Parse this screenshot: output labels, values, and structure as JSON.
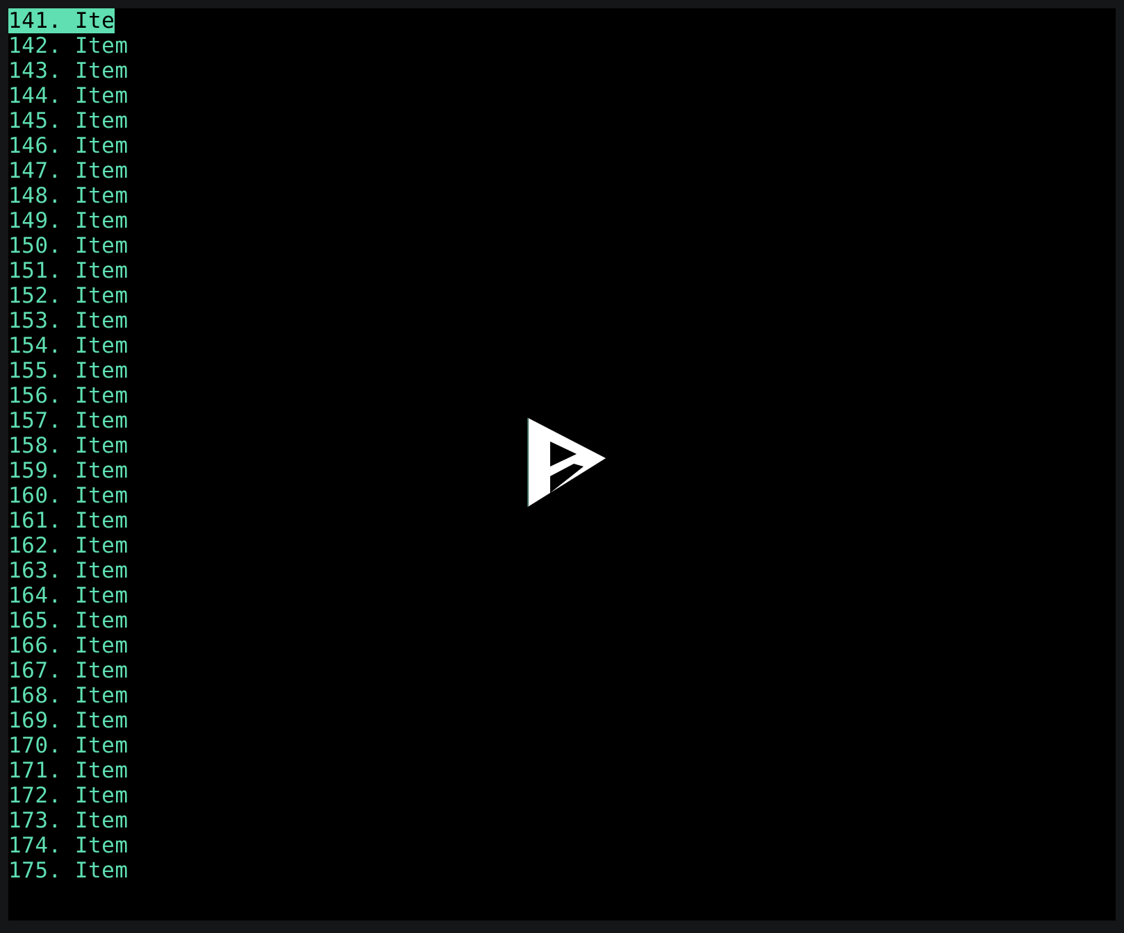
{
  "window": {
    "background_color": "#141617",
    "screen_background_color": "#000000"
  },
  "terminal": {
    "foreground_color": "#5FDFB2",
    "selection_background_color": "#5FDFB2",
    "selection_foreground_color": "#000000",
    "selected_index": 0,
    "first_visible_number": 141,
    "last_visible_number": 175,
    "items": [
      {
        "index": "141.",
        "label": "Item",
        "selected": true
      },
      {
        "index": "142.",
        "label": "Item",
        "selected": false
      },
      {
        "index": "143.",
        "label": "Item",
        "selected": false
      },
      {
        "index": "144.",
        "label": "Item",
        "selected": false
      },
      {
        "index": "145.",
        "label": "Item",
        "selected": false
      },
      {
        "index": "146.",
        "label": "Item",
        "selected": false
      },
      {
        "index": "147.",
        "label": "Item",
        "selected": false
      },
      {
        "index": "148.",
        "label": "Item",
        "selected": false
      },
      {
        "index": "149.",
        "label": "Item",
        "selected": false
      },
      {
        "index": "150.",
        "label": "Item",
        "selected": false
      },
      {
        "index": "151.",
        "label": "Item",
        "selected": false
      },
      {
        "index": "152.",
        "label": "Item",
        "selected": false
      },
      {
        "index": "153.",
        "label": "Item",
        "selected": false
      },
      {
        "index": "154.",
        "label": "Item",
        "selected": false
      },
      {
        "index": "155.",
        "label": "Item",
        "selected": false
      },
      {
        "index": "156.",
        "label": "Item",
        "selected": false
      },
      {
        "index": "157.",
        "label": "Item",
        "selected": false
      },
      {
        "index": "158.",
        "label": "Item",
        "selected": false
      },
      {
        "index": "159.",
        "label": "Item",
        "selected": false
      },
      {
        "index": "160.",
        "label": "Item",
        "selected": false
      },
      {
        "index": "161.",
        "label": "Item",
        "selected": false
      },
      {
        "index": "162.",
        "label": "Item",
        "selected": false
      },
      {
        "index": "163.",
        "label": "Item",
        "selected": false
      },
      {
        "index": "164.",
        "label": "Item",
        "selected": false
      },
      {
        "index": "165.",
        "label": "Item",
        "selected": false
      },
      {
        "index": "166.",
        "label": "Item",
        "selected": false
      },
      {
        "index": "167.",
        "label": "Item",
        "selected": false
      },
      {
        "index": "168.",
        "label": "Item",
        "selected": false
      },
      {
        "index": "169.",
        "label": "Item",
        "selected": false
      },
      {
        "index": "170.",
        "label": "Item",
        "selected": false
      },
      {
        "index": "171.",
        "label": "Item",
        "selected": false
      },
      {
        "index": "172.",
        "label": "Item",
        "selected": false
      },
      {
        "index": "173.",
        "label": "Item",
        "selected": false
      },
      {
        "index": "174.",
        "label": "Item",
        "selected": false
      },
      {
        "index": "175.",
        "label": "Item",
        "selected": false
      }
    ]
  },
  "overlay": {
    "icon": "play-icon",
    "color": "#FFFFFF",
    "edge_color": "#3E6F61"
  }
}
